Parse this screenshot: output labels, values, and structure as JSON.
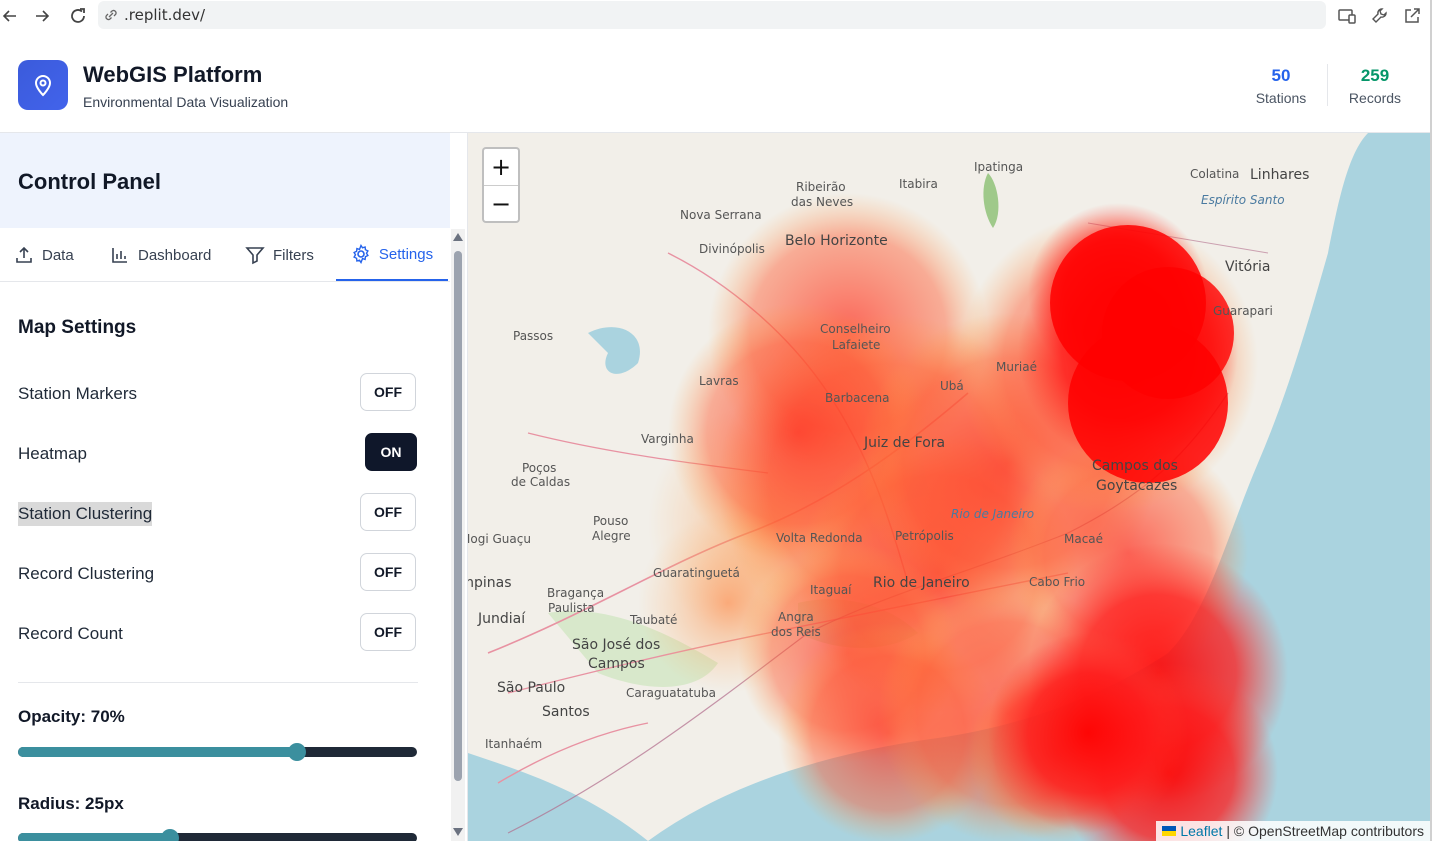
{
  "browser": {
    "url": ".replit.dev/"
  },
  "header": {
    "title": "WebGIS Platform",
    "subtitle": "Environmental Data Visualization",
    "stats": [
      {
        "value": "50",
        "label": "Stations",
        "color": "#2563eb"
      },
      {
        "value": "259",
        "label": "Records",
        "color": "#059669"
      }
    ]
  },
  "sidebar": {
    "title": "Control Panel",
    "tabs": [
      {
        "label": "Data",
        "icon": "upload-icon",
        "active": false
      },
      {
        "label": "Dashboard",
        "icon": "bar-chart-icon",
        "active": false
      },
      {
        "label": "Filters",
        "icon": "filter-icon",
        "active": false
      },
      {
        "label": "Settings",
        "icon": "gear-icon",
        "active": true
      }
    ],
    "section_title": "Map Settings",
    "toggles": [
      {
        "label": "Station Markers",
        "state": "OFF"
      },
      {
        "label": "Heatmap",
        "state": "ON"
      },
      {
        "label": "Station Clustering",
        "state": "OFF"
      },
      {
        "label": "Record Clustering",
        "state": "OFF"
      },
      {
        "label": "Record Count",
        "state": "OFF"
      }
    ],
    "sliders": [
      {
        "label": "Opacity: 70%",
        "value": 0.7
      },
      {
        "label": "Radius: 25px",
        "value": 0.38
      }
    ]
  },
  "map": {
    "zoom_in": "+",
    "zoom_out": "−",
    "attribution_prefix": "Leaflet",
    "attribution_text": "| © OpenStreetMap contributors",
    "labels": {
      "ipatinga": "Ipatinga",
      "colatina": "Colatina",
      "linhares": "Linhares",
      "ribeirao": "Ribeirão",
      "das_neves": "das Neves",
      "itabira": "Itabira",
      "nova_serrana": "Nova Serrana",
      "espirito_santo": "Espírito Santo",
      "divinopolis": "Divinópolis",
      "belo_horizonte": "Belo Horizonte",
      "vitoria": "Vitória",
      "guarapari": "Guarapari",
      "passos": "Passos",
      "conselheiro": "Conselheiro",
      "lafaiete": "Lafaiete",
      "muriae": "Muriaé",
      "lavras": "Lavras",
      "uba": "Ubá",
      "barbacena": "Barbacena",
      "varginha": "Varginha",
      "juiz_de_fora": "Juiz de Fora",
      "pocos": "Poços",
      "de_caldas": "de Caldas",
      "campos_dos": "Campos dos",
      "goytacazes": "Goytacazes",
      "rio_de_janeiro_state": "Rio de Janeiro",
      "pouso": "Pouso",
      "alegre": "Alegre",
      "mogi_guacu": "Mogi Guaçu",
      "volta_redonda": "Volta Redonda",
      "petropolis": "Petrópolis",
      "macae": "Macaé",
      "guaratingueta": "Guaratinguetá",
      "campinas": "Campinas",
      "braganca": "Bragança",
      "paulista": "Paulista",
      "itaguai": "Itaguaí",
      "rio_de_janeiro": "Rio de Janeiro",
      "cabo_frio": "Cabo Frio",
      "jundiai": "Jundiaí",
      "taubate": "Taubaté",
      "angra": "Angra",
      "dos_reis": "dos Reis",
      "sao_jose": "São José dos",
      "campos": "Campos",
      "sao_paulo": "São Paulo",
      "caraguatatuba": "Caraguatatuba",
      "santos": "Santos",
      "itanhaem": "Itanhaém"
    }
  }
}
